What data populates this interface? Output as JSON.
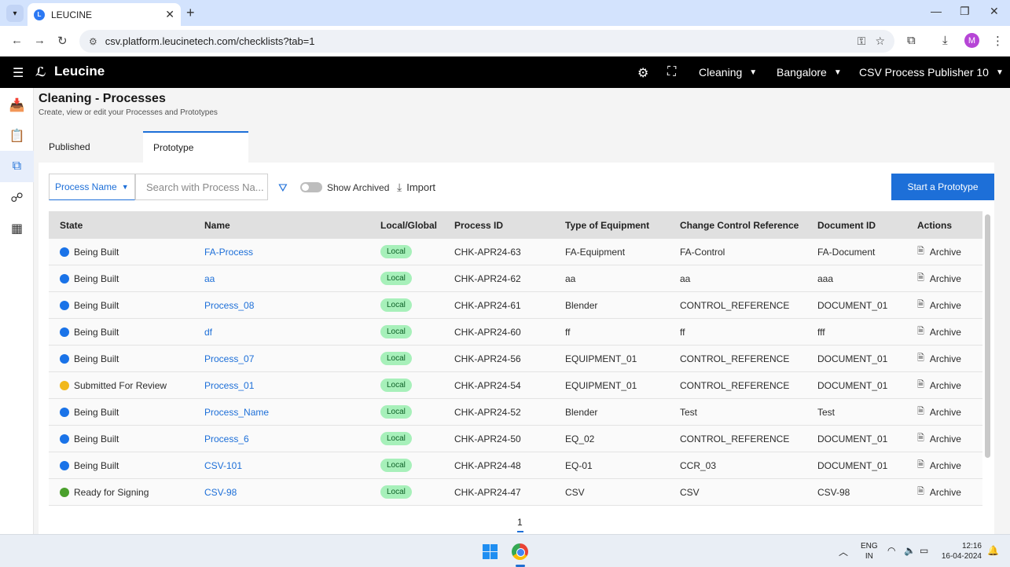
{
  "browser": {
    "tab_title": "LEUCINE",
    "tab_close": "✕",
    "new_tab": "+",
    "url": "csv.platform.leucinetech.com/checklists?tab=1",
    "profile_initial": "M"
  },
  "app": {
    "logo_text": "Leucine",
    "facility": "Cleaning",
    "location": "Bangalore",
    "user": "CSV Process Publisher 10"
  },
  "page": {
    "title": "Cleaning - Processes",
    "subtitle": "Create, view or edit your Processes and Prototypes"
  },
  "tabs": [
    {
      "label": "Published",
      "active": false
    },
    {
      "label": "Prototype",
      "active": true
    }
  ],
  "toolbar": {
    "filter_selected": "Process Name",
    "search_placeholder": "Search with Process Na...",
    "show_archived_label": "Show Archived",
    "show_archived_on": false,
    "import_label": "Import",
    "start_button_label": "Start a Prototype"
  },
  "table": {
    "columns": [
      "State",
      "Name",
      "Local/Global",
      "Process ID",
      "Type of Equipment",
      "Change Control Reference",
      "Document ID",
      "Actions"
    ],
    "rows": [
      {
        "state": "Being Built",
        "state_color": "#1a73e8",
        "name": "FA-Process",
        "scope": "Local",
        "pid": "CHK-APR24-63",
        "equipment": "FA-Equipment",
        "ccr": "FA-Control",
        "doc": "FA-Document",
        "action": "Archive"
      },
      {
        "state": "Being Built",
        "state_color": "#1a73e8",
        "name": "aa",
        "scope": "Local",
        "pid": "CHK-APR24-62",
        "equipment": "aa",
        "ccr": "aa",
        "doc": "aaa",
        "action": "Archive"
      },
      {
        "state": "Being Built",
        "state_color": "#1a73e8",
        "name": "Process_08",
        "scope": "Local",
        "pid": "CHK-APR24-61",
        "equipment": "Blender",
        "ccr": "CONTROL_REFERENCE",
        "doc": "DOCUMENT_01",
        "action": "Archive"
      },
      {
        "state": "Being Built",
        "state_color": "#1a73e8",
        "name": "df",
        "scope": "Local",
        "pid": "CHK-APR24-60",
        "equipment": "ff",
        "ccr": "ff",
        "doc": "fff",
        "action": "Archive"
      },
      {
        "state": "Being Built",
        "state_color": "#1a73e8",
        "name": "Process_07",
        "scope": "Local",
        "pid": "CHK-APR24-56",
        "equipment": "EQUIPMENT_01",
        "ccr": "CONTROL_REFERENCE",
        "doc": "DOCUMENT_01",
        "action": "Archive"
      },
      {
        "state": "Submitted For Review",
        "state_color": "#f1b81a",
        "name": "Process_01",
        "scope": "Local",
        "pid": "CHK-APR24-54",
        "equipment": "EQUIPMENT_01",
        "ccr": "CONTROL_REFERENCE",
        "doc": "DOCUMENT_01",
        "action": "Archive"
      },
      {
        "state": "Being Built",
        "state_color": "#1a73e8",
        "name": "Process_Name",
        "scope": "Local",
        "pid": "CHK-APR24-52",
        "equipment": "Blender",
        "ccr": "Test",
        "doc": "Test",
        "action": "Archive"
      },
      {
        "state": "Being Built",
        "state_color": "#1a73e8",
        "name": "Process_6",
        "scope": "Local",
        "pid": "CHK-APR24-50",
        "equipment": "EQ_02",
        "ccr": "CONTROL_REFERENCE",
        "doc": "DOCUMENT_01",
        "action": "Archive"
      },
      {
        "state": "Being Built",
        "state_color": "#1a73e8",
        "name": "CSV-101",
        "scope": "Local",
        "pid": "CHK-APR24-48",
        "equipment": "EQ-01",
        "ccr": "CCR_03",
        "doc": "DOCUMENT_01",
        "action": "Archive"
      },
      {
        "state": "Ready for Signing",
        "state_color": "#4aa02c",
        "name": "CSV-98",
        "scope": "Local",
        "pid": "CHK-APR24-47",
        "equipment": "CSV",
        "ccr": "CSV",
        "doc": "CSV-98",
        "action": "Archive"
      }
    ]
  },
  "pagination": {
    "current_page": "1"
  },
  "taskbar": {
    "lang_line1": "ENG",
    "lang_line2": "IN",
    "time": "12:16",
    "date": "16-04-2024"
  },
  "colors": {
    "accent": "#1d6fd8",
    "header_bg": "#000000",
    "local_pill_bg": "#a7f0ba"
  }
}
